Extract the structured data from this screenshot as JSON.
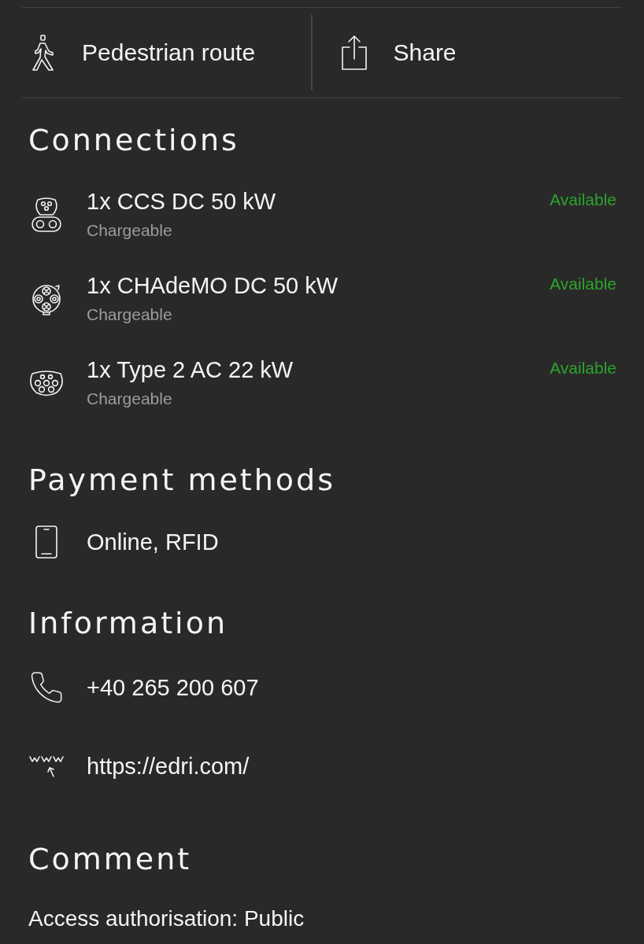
{
  "actions": [
    {
      "kind": "pedestrian",
      "label": "Pedestrian route"
    },
    {
      "kind": "share",
      "label": "Share"
    }
  ],
  "connections": {
    "title": "Connections",
    "items": [
      {
        "kind": "ccs",
        "name": "1x CCS DC 50 kW",
        "detail": "Chargeable",
        "status": "Available"
      },
      {
        "kind": "chademo",
        "name": "1x CHAdeMO DC 50 kW",
        "detail": "Chargeable",
        "status": "Available"
      },
      {
        "kind": "type2",
        "name": "1x Type 2 AC 22 kW",
        "detail": "Chargeable",
        "status": "Available"
      }
    ]
  },
  "payment_methods": {
    "title": "Payment methods",
    "items": [
      {
        "kind": "device",
        "text": "Online, RFID"
      }
    ]
  },
  "information": {
    "title": "Information",
    "items": [
      {
        "kind": "phone",
        "text": "+40 265 200 607"
      },
      {
        "kind": "web",
        "text": "https://edri.com/"
      }
    ]
  },
  "comment": {
    "title": "Comment",
    "text": "Access authorisation: Public"
  }
}
